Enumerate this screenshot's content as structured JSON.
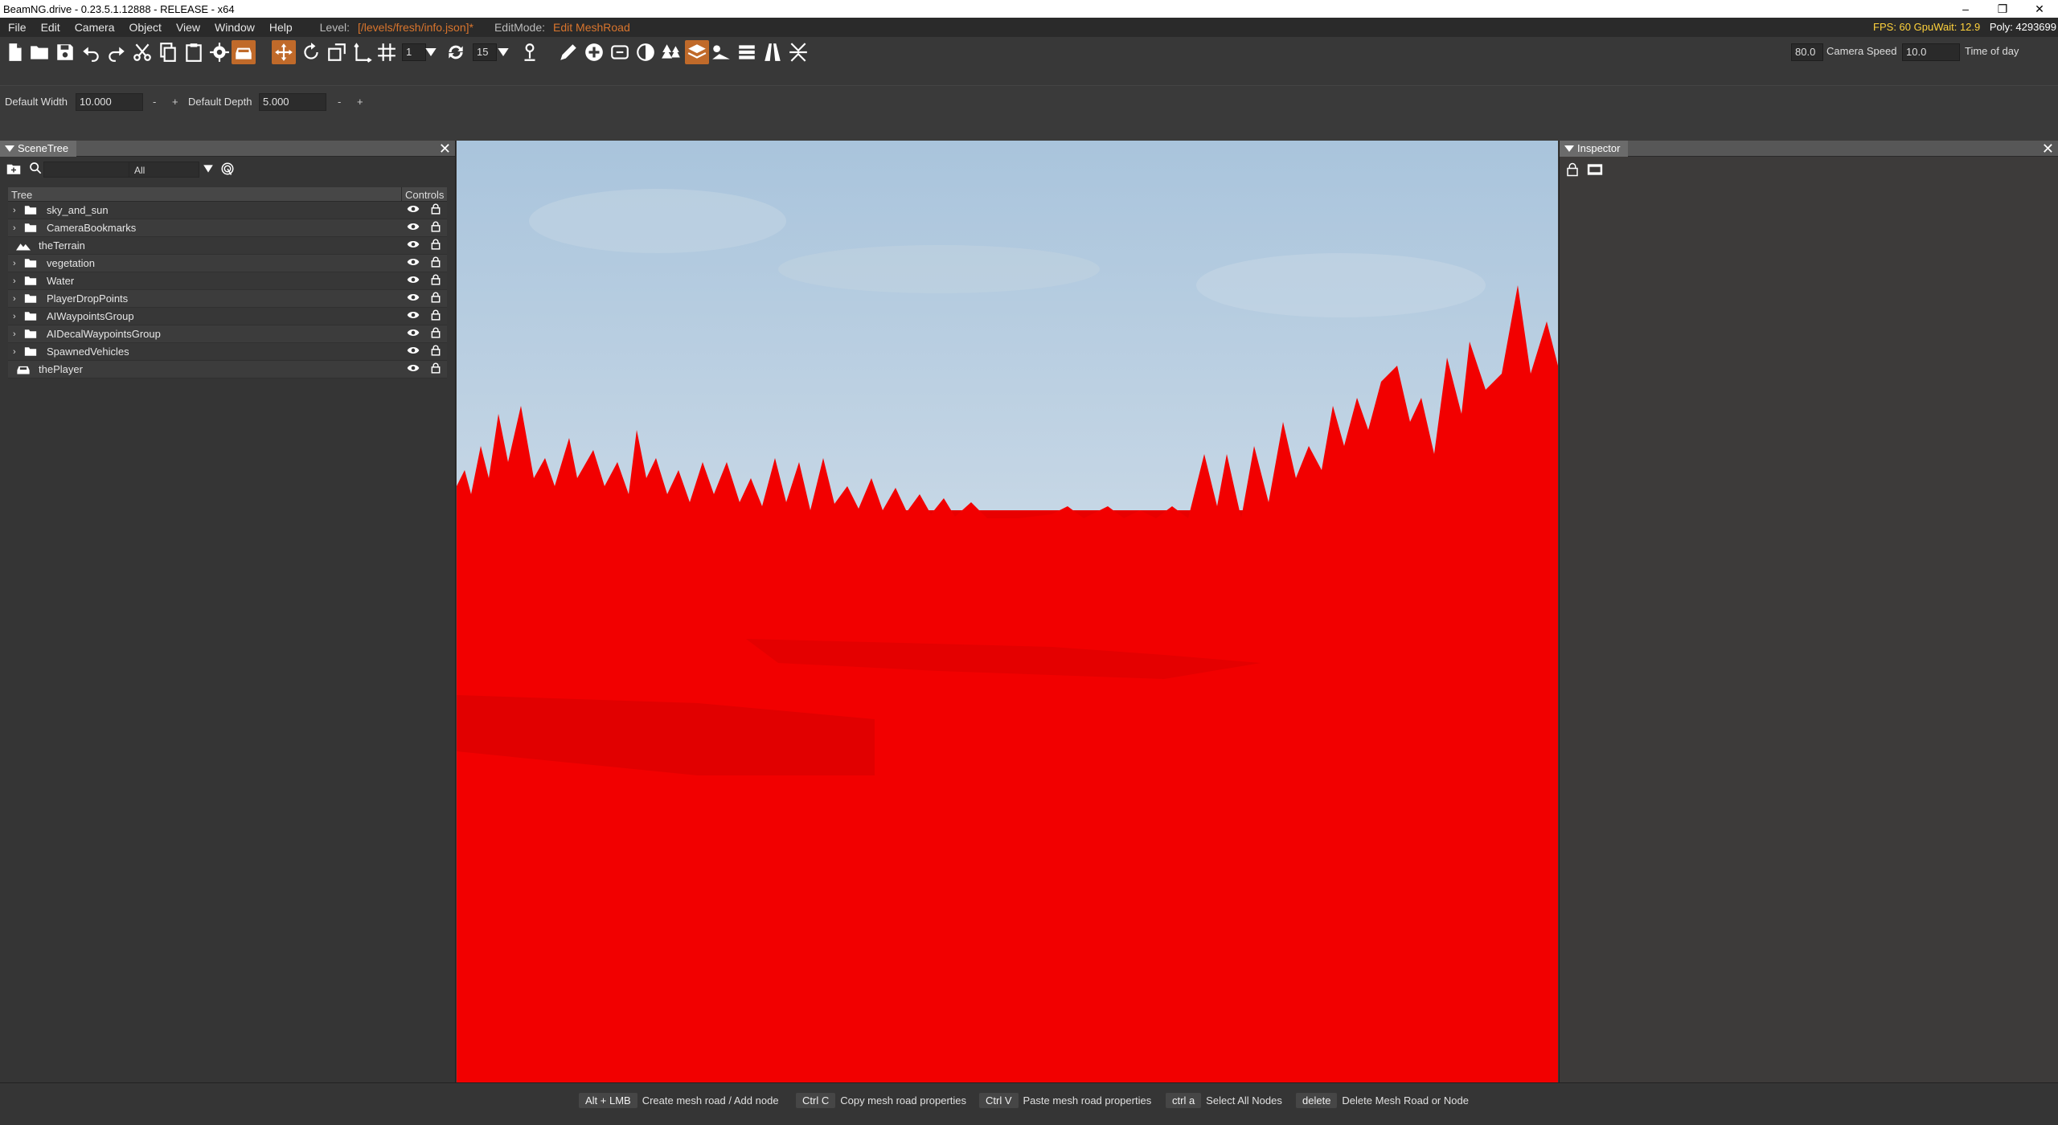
{
  "window": {
    "title": "BeamNG.drive - 0.23.5.1.12888 - RELEASE - x64",
    "minimize": "–",
    "restore": "❐",
    "close": "✕"
  },
  "menu": {
    "items": [
      "File",
      "Edit",
      "Camera",
      "Object",
      "View",
      "Window",
      "Help"
    ],
    "level_label": "Level:",
    "level_value": "[/levels/fresh/info.json]*",
    "editmode_label": "EditMode:",
    "editmode_value": "Edit MeshRoad",
    "fps": "FPS: 60  GpuWait: 12.9",
    "poly": "Poly: 4293699"
  },
  "toolbar": {
    "grid_value": "1",
    "rotate_value": "15",
    "camera_speed_value": "80.0",
    "camera_speed_label": "Camera Speed",
    "time_value": "10.0",
    "time_label": "Time of day",
    "icons": [
      "new-file-icon",
      "open-folder-icon",
      "save-icon",
      "undo-icon",
      "redo-icon",
      "cut-icon",
      "copy-icon",
      "paste-icon",
      "settings-icon",
      "vehicle-icon",
      "move-gizmo-icon",
      "rotate-gizmo-icon",
      "scale-gizmo-icon",
      "axis-local-icon",
      "grid-snap-icon",
      "rotate-snap-icon",
      "terrain-snap-icon",
      "pencil-icon",
      "add-icon",
      "decal-icon",
      "color-wheel-icon",
      "forest-icon",
      "road-icon",
      "meshroad-icon",
      "river-icon",
      "road-edit-icon",
      "collapse-icon"
    ]
  },
  "options": {
    "width_label": "Default Width",
    "width_value": "10.000",
    "depth_label": "Default Depth",
    "depth_value": "5.000",
    "minus": "-",
    "plus": "+"
  },
  "scenetree": {
    "title": "SceneTree",
    "filter": "All",
    "col_tree": "Tree",
    "col_controls": "Controls",
    "rows": [
      {
        "name": "sky_and_sun",
        "type": "folder",
        "expandable": true
      },
      {
        "name": "CameraBookmarks",
        "type": "folder",
        "expandable": true
      },
      {
        "name": "theTerrain",
        "type": "terrain",
        "expandable": false
      },
      {
        "name": "vegetation",
        "type": "folder",
        "expandable": true
      },
      {
        "name": "Water",
        "type": "folder",
        "expandable": true
      },
      {
        "name": "PlayerDropPoints",
        "type": "folder",
        "expandable": true
      },
      {
        "name": "AIWaypointsGroup",
        "type": "folder",
        "expandable": true
      },
      {
        "name": "AIDecalWaypointsGroup",
        "type": "folder",
        "expandable": true
      },
      {
        "name": "SpawnedVehicles",
        "type": "folder",
        "expandable": true
      },
      {
        "name": "thePlayer",
        "type": "vehicle",
        "expandable": false
      }
    ]
  },
  "inspector": {
    "title": "Inspector"
  },
  "status": {
    "hints": [
      {
        "key": "Alt + LMB",
        "desc": "Create mesh road / Add node"
      },
      {
        "key": "Ctrl C",
        "desc": "Copy mesh road properties"
      },
      {
        "key": "Ctrl V",
        "desc": "Paste mesh road properties"
      },
      {
        "key": "ctrl a",
        "desc": "Select All Nodes"
      },
      {
        "key": "delete",
        "desc": "Delete Mesh Road or Node"
      }
    ]
  },
  "colors": {
    "accent": "#c06a2a",
    "terrain_red": "#ff0000",
    "sky": "#b8d2e6",
    "fps_yellow": "#ffd23c",
    "level_orange": "#d9752d"
  }
}
